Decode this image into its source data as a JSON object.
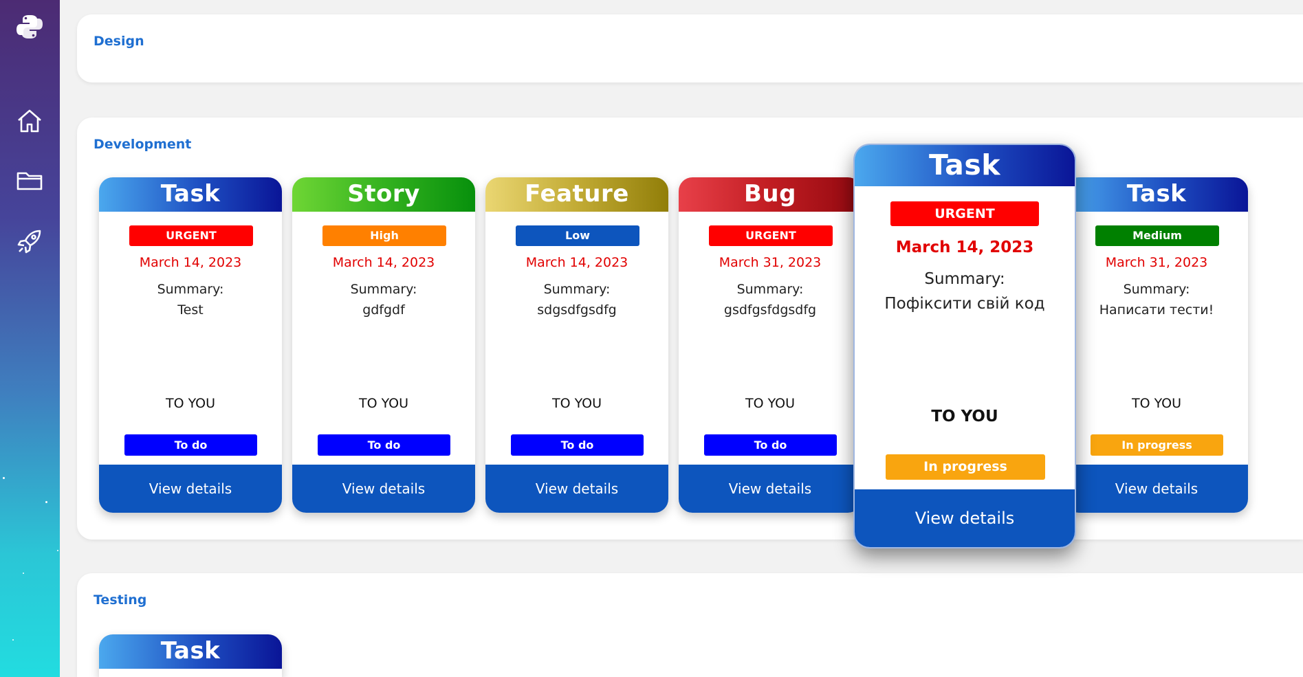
{
  "sidebar": {
    "icons": [
      "python-logo-icon",
      "home-icon",
      "folder-icon",
      "rocket-icon"
    ]
  },
  "sections": [
    {
      "title": "Design"
    },
    {
      "title": "Development"
    },
    {
      "title": "Testing"
    }
  ],
  "summary_label": "Summary:",
  "view_details_label": "View details",
  "development_cards": [
    {
      "type": "Task",
      "priority": "URGENT",
      "date": "March 14, 2023",
      "summary": "Test",
      "assignee": "TO YOU",
      "status": "To do"
    },
    {
      "type": "Story",
      "priority": "High",
      "date": "March 14, 2023",
      "summary": "gdfgdf",
      "assignee": "TO YOU",
      "status": "To do"
    },
    {
      "type": "Feature",
      "priority": "Low",
      "date": "March 14, 2023",
      "summary": "sdgsdfgsdfg",
      "assignee": "TO YOU",
      "status": "To do"
    },
    {
      "type": "Bug",
      "priority": "URGENT",
      "date": "March 31, 2023",
      "summary": "gsdfgsfdgsdfg",
      "assignee": "TO YOU",
      "status": "To do"
    },
    {
      "type": "Task",
      "priority": "URGENT",
      "date": "March 14, 2023",
      "summary": "Пофіксити свій код",
      "assignee": "TO YOU",
      "status": "In progress"
    },
    {
      "type": "Task",
      "priority": "Medium",
      "date": "March 31, 2023",
      "summary": "Написати тести!",
      "assignee": "TO YOU",
      "status": "In progress"
    }
  ],
  "testing_cards": [
    {
      "type": "Task"
    }
  ],
  "colors": {
    "section_title": "#1f6fd1",
    "urgent": "#ff0000",
    "high": "#ff8000",
    "low": "#0d55bd",
    "medium": "#008000",
    "status_todo": "#0000ff",
    "status_in_progress": "#f9a50f",
    "view_button": "#0d55bd",
    "date_text": "#e10000"
  }
}
